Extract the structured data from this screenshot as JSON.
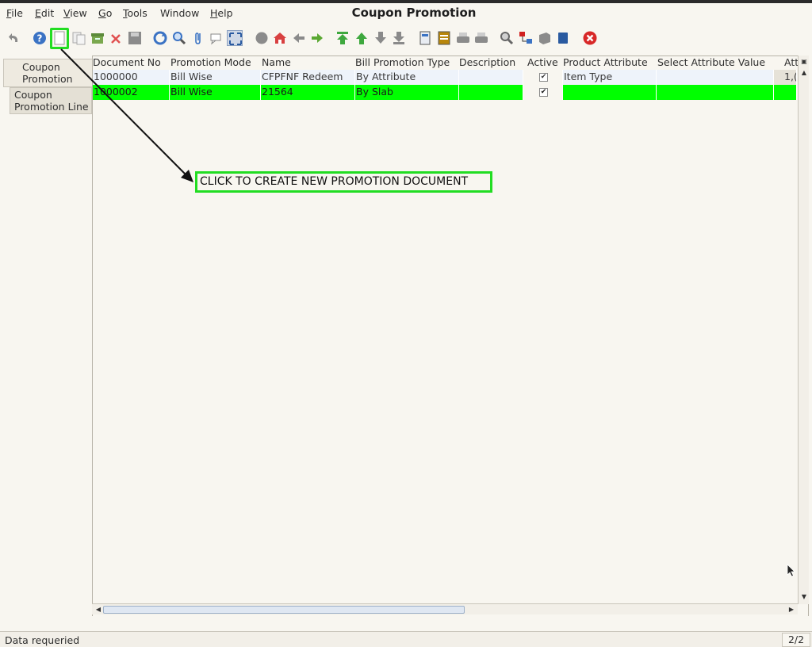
{
  "window": {
    "title": "Coupon Promotion"
  },
  "menu": [
    {
      "label": "File",
      "ul": "F",
      "rest": "ile"
    },
    {
      "label": "Edit",
      "ul": "E",
      "rest": "dit"
    },
    {
      "label": "View",
      "ul": "V",
      "rest": "iew"
    },
    {
      "label": "Go",
      "ul": "G",
      "rest": "o"
    },
    {
      "label": "Tools",
      "ul": "T",
      "rest": "ools"
    },
    {
      "label": "Window",
      "ul": "",
      "rest": "Window"
    },
    {
      "label": "Help",
      "ul": "H",
      "rest": "elp"
    }
  ],
  "toolbar": {
    "icons": [
      "undo-icon",
      "help-icon",
      "new-record-icon",
      "copy-record-icon",
      "archive-icon",
      "delete-icon",
      "save-icon",
      "refresh-icon",
      "find-icon",
      "attachment-icon",
      "chat-icon",
      "toggle-grid-icon",
      "history-icon",
      "home-icon",
      "previous-icon",
      "next-icon",
      "first-record-icon",
      "previous-record-icon",
      "next-record-icon",
      "last-record-icon",
      "report-icon",
      "print-preview-icon",
      "print-icon",
      "print-all-icon",
      "zoom-across-icon",
      "workflow-icon",
      "product-info-icon",
      "request-icon",
      "close-window-icon"
    ]
  },
  "tabs": [
    {
      "line1": "Coupon",
      "line2": "Promotion"
    },
    {
      "line1": "Coupon",
      "line2": "Promotion Line"
    }
  ],
  "grid": {
    "columns": [
      "Document No",
      "Promotion Mode",
      "Name",
      "Bill Promotion Type",
      "Description",
      "Active",
      "Product Attribute",
      "Select Attribute Value",
      "Attr"
    ],
    "rows": [
      {
        "document_no": "1000000",
        "promotion_mode": "Bill Wise",
        "name": "CFPFNF Redeem",
        "bill_promotion_type": "By Attribute",
        "description": "",
        "active": "✔",
        "product_attribute": "Item Type",
        "select_attribute_value": "",
        "attr": "1,("
      },
      {
        "document_no": "1000002",
        "promotion_mode": "Bill Wise",
        "name": "21564",
        "bill_promotion_type": "By Slab",
        "description": "",
        "active": "✔",
        "product_attribute": "",
        "select_attribute_value": "",
        "attr": ""
      }
    ]
  },
  "annotation": {
    "text": "CLICK TO CREATE NEW PROMOTION DOCUMENT",
    "color": "#22dd22"
  },
  "status": {
    "message": "Data requeried",
    "record_count": "2/2"
  },
  "colors": {
    "selected_row": "#00ff00",
    "background": "#f8f6f0"
  }
}
